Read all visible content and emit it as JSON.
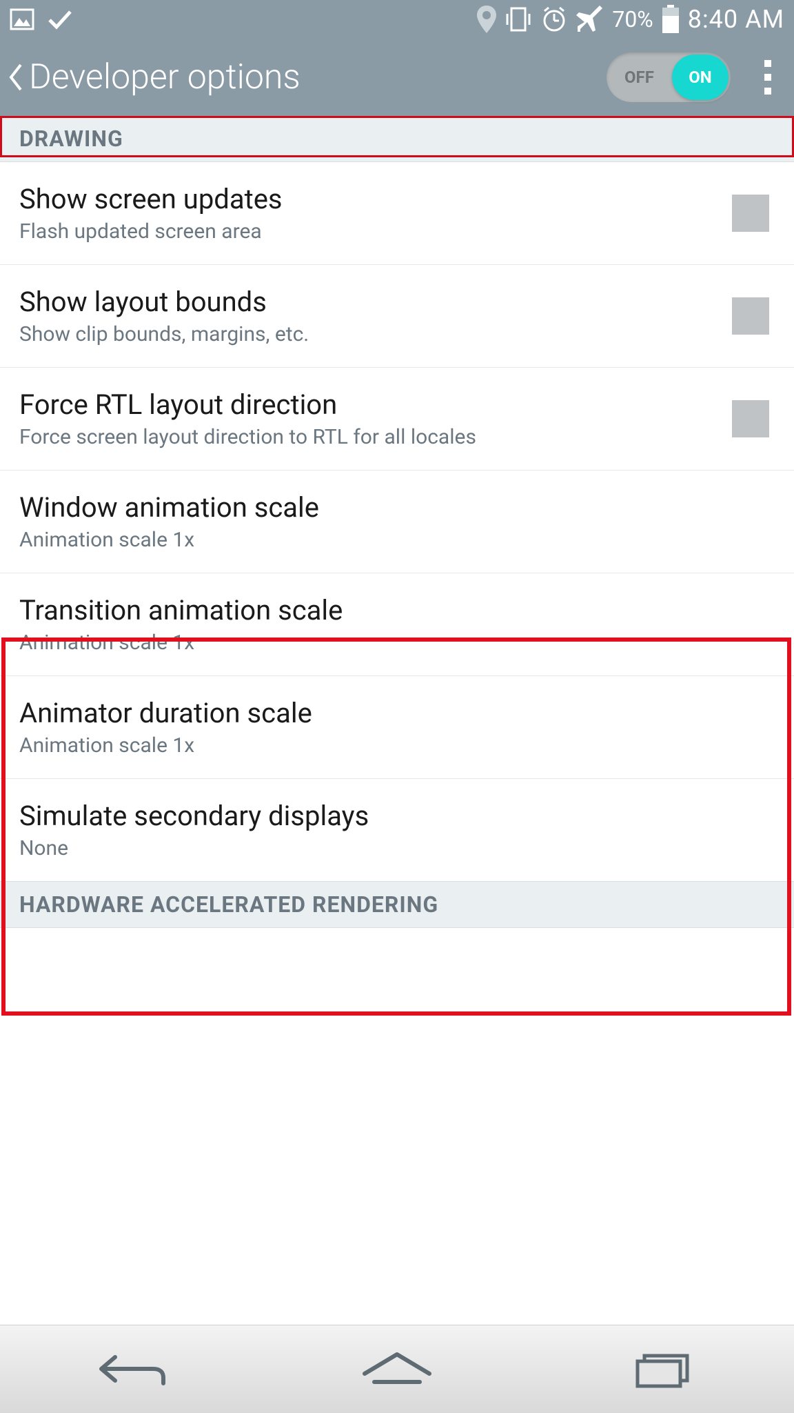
{
  "status": {
    "battery_pct": "70%",
    "time": "8:40 AM"
  },
  "header": {
    "title": "Developer options",
    "toggle_off": "OFF",
    "toggle_on": "ON"
  },
  "sections": {
    "drawing": "DRAWING",
    "hardware": "HARDWARE ACCELERATED RENDERING"
  },
  "rows": {
    "show_screen_updates": {
      "title": "Show screen updates",
      "sub": "Flash updated screen area"
    },
    "show_layout_bounds": {
      "title": "Show layout bounds",
      "sub": "Show clip bounds, margins, etc."
    },
    "force_rtl": {
      "title": "Force RTL layout direction",
      "sub": "Force screen layout direction to RTL for all locales"
    },
    "window_anim": {
      "title": "Window animation scale",
      "sub": "Animation scale 1x"
    },
    "transition_anim": {
      "title": "Transition animation scale",
      "sub": "Animation scale 1x"
    },
    "animator_dur": {
      "title": "Animator duration scale",
      "sub": "Animation scale 1x"
    },
    "sim_secondary": {
      "title": "Simulate secondary displays",
      "sub": "None"
    }
  }
}
